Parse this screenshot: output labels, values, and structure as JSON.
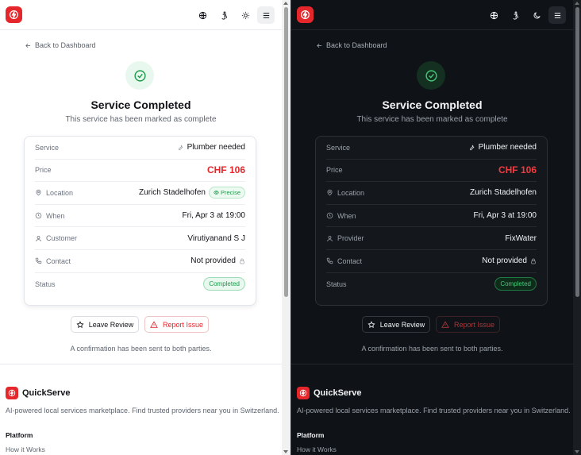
{
  "colors": {
    "accent": "#e5262a",
    "success": "#1e9a4b"
  },
  "light": {
    "back_label": "Back to Dashboard",
    "title": "Service Completed",
    "subtitle": "This service has been marked as complete",
    "rows": {
      "service": {
        "label": "Service",
        "value": "Plumber needed"
      },
      "price": {
        "label": "Price",
        "value": "CHF 106"
      },
      "location": {
        "label": "Location",
        "value": "Zurich Stadelhofen",
        "badge": "Precise"
      },
      "when": {
        "label": "When",
        "value": "Fri, Apr 3 at 19:00"
      },
      "person": {
        "label": "Customer",
        "value": "Virutiyanand S J"
      },
      "contact": {
        "label": "Contact",
        "value": "Not provided"
      },
      "status": {
        "label": "Status",
        "value": "Completed"
      }
    },
    "review_label": "Leave Review",
    "report_label": "Report Issue",
    "confirmation": "A confirmation has been sent to both parties.",
    "footer": {
      "brand": "QuickServe",
      "tagline": "AI-powered local services marketplace. Find trusted providers near you in Switzerland.",
      "section": "Platform",
      "link": "How it Works"
    }
  },
  "dark": {
    "back_label": "Back to Dashboard",
    "title": "Service Completed",
    "subtitle": "This service has been marked as complete",
    "rows": {
      "service": {
        "label": "Service",
        "value": "Plumber needed"
      },
      "price": {
        "label": "Price",
        "value": "CHF 106"
      },
      "location": {
        "label": "Location",
        "value": "Zurich Stadelhofen"
      },
      "when": {
        "label": "When",
        "value": "Fri, Apr 3 at 19:00"
      },
      "person": {
        "label": "Provider",
        "value": "FixWater"
      },
      "contact": {
        "label": "Contact",
        "value": "Not provided"
      },
      "status": {
        "label": "Status",
        "value": "Completed"
      }
    },
    "review_label": "Leave Review",
    "report_label": "Report Issue",
    "confirmation": "A confirmation has been sent to both parties.",
    "footer": {
      "brand": "QuickServe",
      "tagline": "AI-powered local services marketplace. Find trusted providers near you in Switzerland.",
      "section": "Platform",
      "link": "How it Works"
    }
  }
}
